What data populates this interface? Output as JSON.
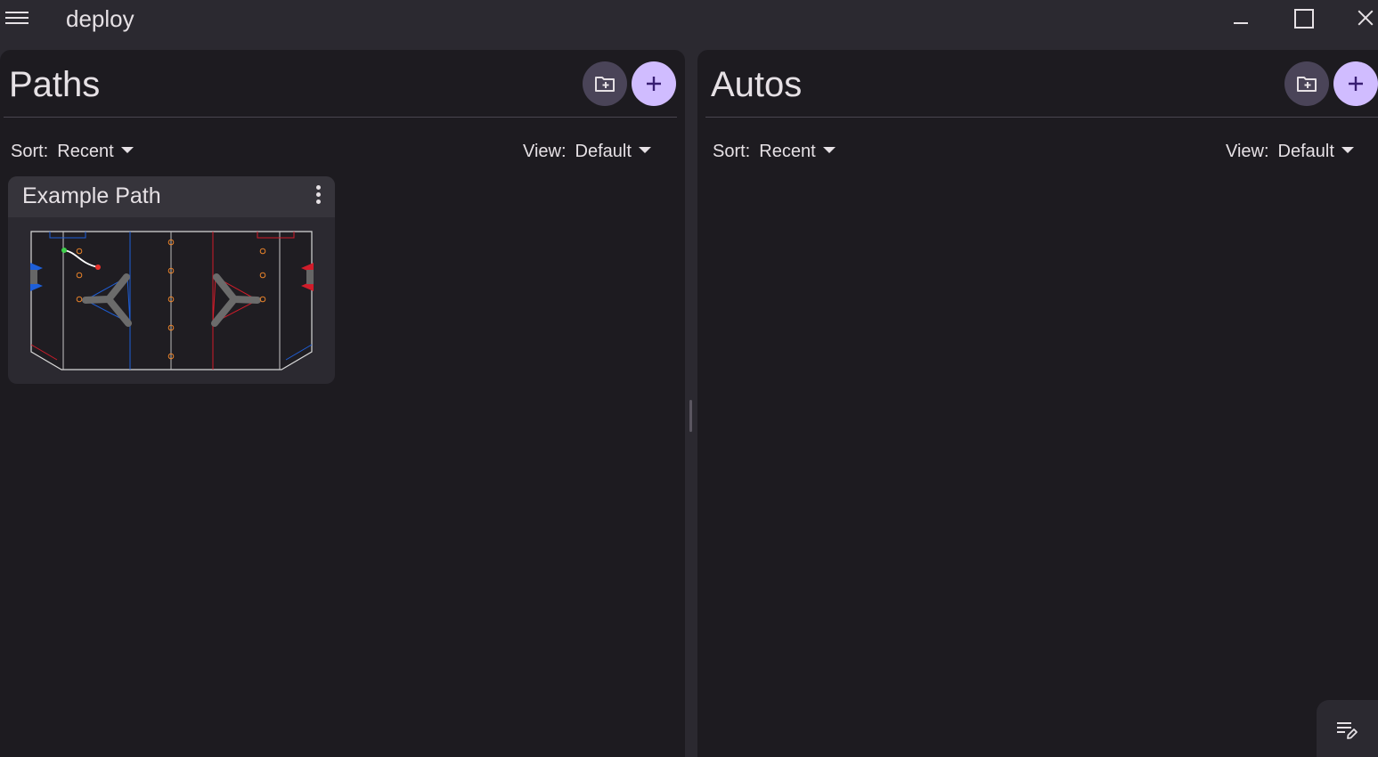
{
  "app": {
    "title": "deploy"
  },
  "window_controls": [
    "minimize-icon",
    "maximize-icon",
    "close-icon"
  ],
  "paths_panel": {
    "title": "Paths",
    "sort": {
      "label": "Sort:",
      "value": "Recent"
    },
    "view": {
      "label": "View:",
      "value": "Default"
    },
    "items": [
      {
        "name": "Example Path"
      }
    ]
  },
  "autos_panel": {
    "title": "Autos",
    "sort": {
      "label": "Sort:",
      "value": "Recent"
    },
    "view": {
      "label": "View:",
      "value": "Default"
    },
    "items": []
  },
  "colors": {
    "background": "#1d1b20",
    "surface": "#2b2930",
    "primary": "#d0bcff",
    "secondary_container": "#4a4458",
    "blue_alliance": "#1e5fd9",
    "red_alliance": "#d01c2a",
    "note_ring": "#e8822a"
  }
}
